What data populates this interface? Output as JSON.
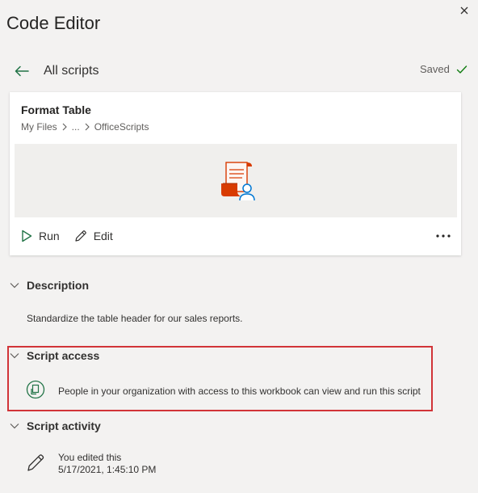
{
  "header": {
    "title": "Code Editor",
    "close_icon": "close-icon"
  },
  "nav": {
    "back_label": "All scripts",
    "status": "Saved",
    "status_color": "#107c10",
    "accent_color": "#217346"
  },
  "script_card": {
    "name": "Format Table",
    "breadcrumb": [
      "My Files",
      "...",
      "OfficeScripts"
    ],
    "run_label": "Run",
    "edit_label": "Edit",
    "more_icon": "more-icon",
    "preview_icon": "script-file-icon",
    "icon_color": "#d83b01",
    "user_color": "#0078d4"
  },
  "sections": {
    "description": {
      "title": "Description",
      "text": "Standardize the table header for our sales reports."
    },
    "script_access": {
      "title": "Script access",
      "text": "People in your organization with access to this workbook can view and run this script",
      "highlight_color": "#d13438"
    },
    "script_activity": {
      "title": "Script activity",
      "entry_action": "You edited this",
      "entry_time": "5/17/2021, 1:45:10 PM"
    }
  }
}
